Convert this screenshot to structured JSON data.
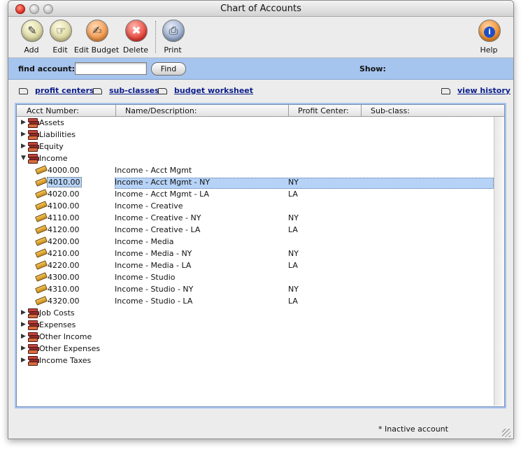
{
  "window": {
    "title": "Chart of Accounts"
  },
  "toolbar": {
    "add": "Add",
    "edit": "Edit",
    "edit_budget": "Edit Budget",
    "delete": "Delete",
    "print": "Print",
    "help": "Help"
  },
  "search": {
    "label": "find account:",
    "value": "",
    "button": "Find",
    "show_label": "Show:"
  },
  "links": {
    "profit_centers": "profit centers",
    "sub_classes": "sub-classes",
    "budget_worksheet": "budget worksheet",
    "view_history": "view history"
  },
  "columns": {
    "acct_number": "Acct Number:",
    "name": "Name/Description:",
    "profit_center": "Profit Center:",
    "sub_class": "Sub-class:"
  },
  "groups": [
    {
      "label": "Assets",
      "expanded": false
    },
    {
      "label": "Liabilities",
      "expanded": false
    },
    {
      "label": "Equity",
      "expanded": false
    },
    {
      "label": "Income",
      "expanded": true
    }
  ],
  "income_accounts": [
    {
      "acct": "4000.00",
      "name": "Income - Acct Mgmt",
      "pc": ""
    },
    {
      "acct": "4010.00",
      "name": "Income - Acct Mgmt - NY",
      "pc": "NY",
      "selected": true
    },
    {
      "acct": "4020.00",
      "name": "Income - Acct Mgmt - LA",
      "pc": "LA"
    },
    {
      "acct": "4100.00",
      "name": "Income - Creative",
      "pc": ""
    },
    {
      "acct": "4110.00",
      "name": "Income - Creative - NY",
      "pc": "NY"
    },
    {
      "acct": "4120.00",
      "name": "Income - Creative - LA",
      "pc": "LA"
    },
    {
      "acct": "4200.00",
      "name": "Income - Media",
      "pc": ""
    },
    {
      "acct": "4210.00",
      "name": "Income - Media - NY",
      "pc": "NY"
    },
    {
      "acct": "4220.00",
      "name": "Income - Media - LA",
      "pc": "LA"
    },
    {
      "acct": "4300.00",
      "name": "Income - Studio",
      "pc": ""
    },
    {
      "acct": "4310.00",
      "name": "Income - Studio - NY",
      "pc": "NY"
    },
    {
      "acct": "4320.00",
      "name": "Income - Studio - LA",
      "pc": "LA"
    }
  ],
  "groups_after": [
    {
      "label": "Job Costs"
    },
    {
      "label": "Expenses"
    },
    {
      "label": "Other Income"
    },
    {
      "label": "Other Expenses"
    },
    {
      "label": "Income Taxes"
    }
  ],
  "footer": {
    "inactive_note": "* Inactive account"
  },
  "icons": {
    "collapsed": "▶",
    "expanded": "▼",
    "help_glyph": "i",
    "delete_glyph": "🗑"
  },
  "colors": {
    "search_bar": "#a5c4ee",
    "selection": "#b6d3f7",
    "link": "#0b1e8a"
  }
}
